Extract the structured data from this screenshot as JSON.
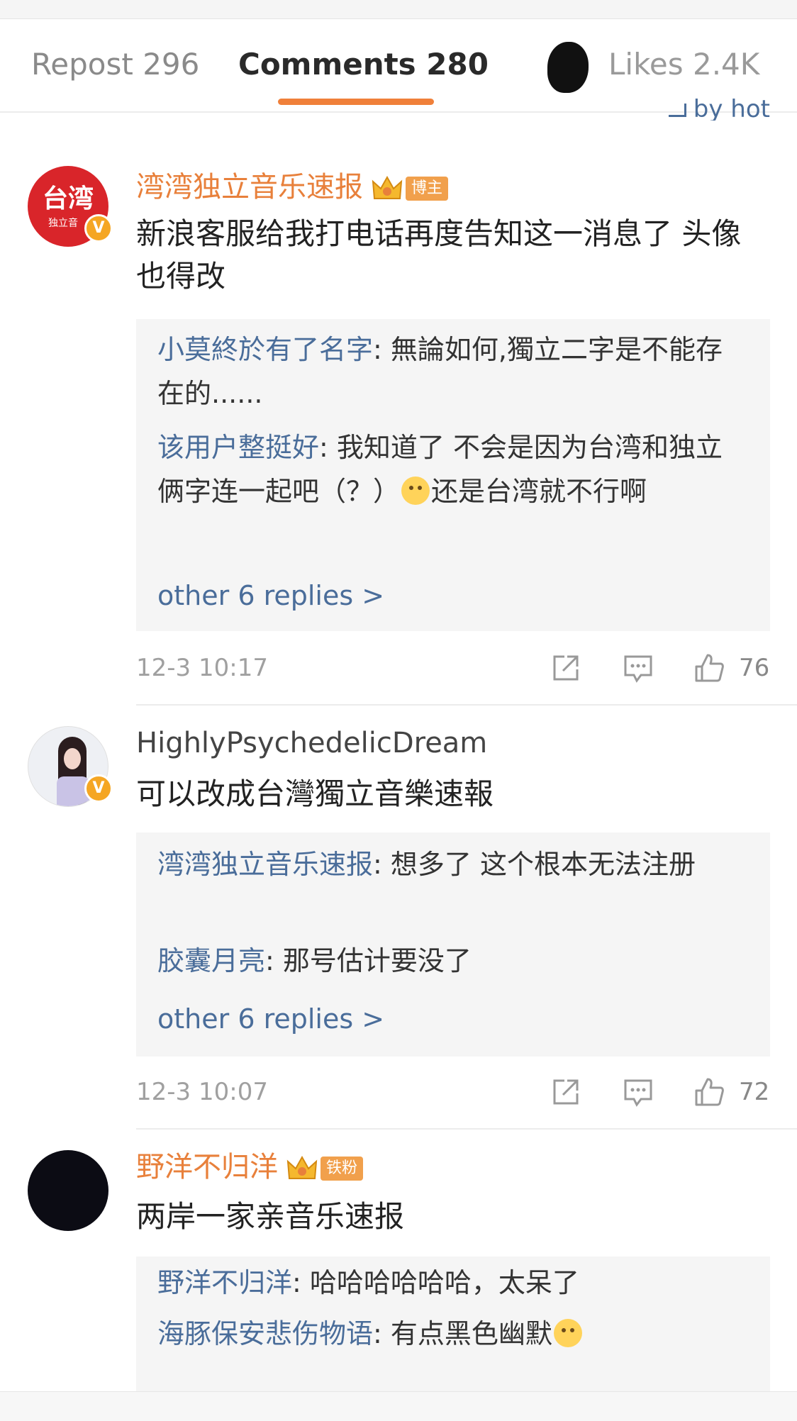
{
  "tabs": {
    "repost": "Repost 296",
    "comments": "Comments 280",
    "likes": "Likes 2.4K"
  },
  "sort_hint": "by hot",
  "comments": [
    {
      "username": "湾湾独立音乐速报",
      "badge": "博主",
      "avatar_text": "台湾",
      "avatar_subtext": "独立音",
      "body": "新浪客服给我打电话再度告知这一消息了 头像也得改",
      "replies": [
        {
          "name": "小莫終於有了名字",
          "text": ": 無論如何,獨立二字是不能存在的......"
        },
        {
          "name": "该用户整挺好",
          "text_a": ": 我知道了 不会是因为台湾和独立俩字连一起吧（？）",
          "text_b": "还是台湾就不行啊"
        }
      ],
      "more": "other 6 replies >",
      "time": "12-3 10:17",
      "likes": "76"
    },
    {
      "username": "HighlyPsychedelicDream",
      "body": "可以改成台灣獨立音樂速報",
      "replies": [
        {
          "name": "湾湾独立音乐速报",
          "text": ": 想多了 这个根本无法注册"
        },
        {
          "name": "胶囊月亮",
          "text": ": 那号估计要没了"
        }
      ],
      "more": "other 6 replies >",
      "time": "12-3 10:07",
      "likes": "72"
    },
    {
      "username": "野洋不归洋",
      "badge": "铁粉",
      "body": "两岸一家亲音乐速报",
      "replies": [
        {
          "name": "野洋不归洋",
          "text": ": 哈哈哈哈哈哈，太呆了"
        },
        {
          "name": "海豚保安悲伤物语",
          "text": ": 有点黑色幽默"
        }
      ]
    }
  ],
  "colors": {
    "accent": "#f0803a",
    "link": "#4a6d9a",
    "username_orange": "#e8803b",
    "reply_bg": "#f5f5f5"
  }
}
